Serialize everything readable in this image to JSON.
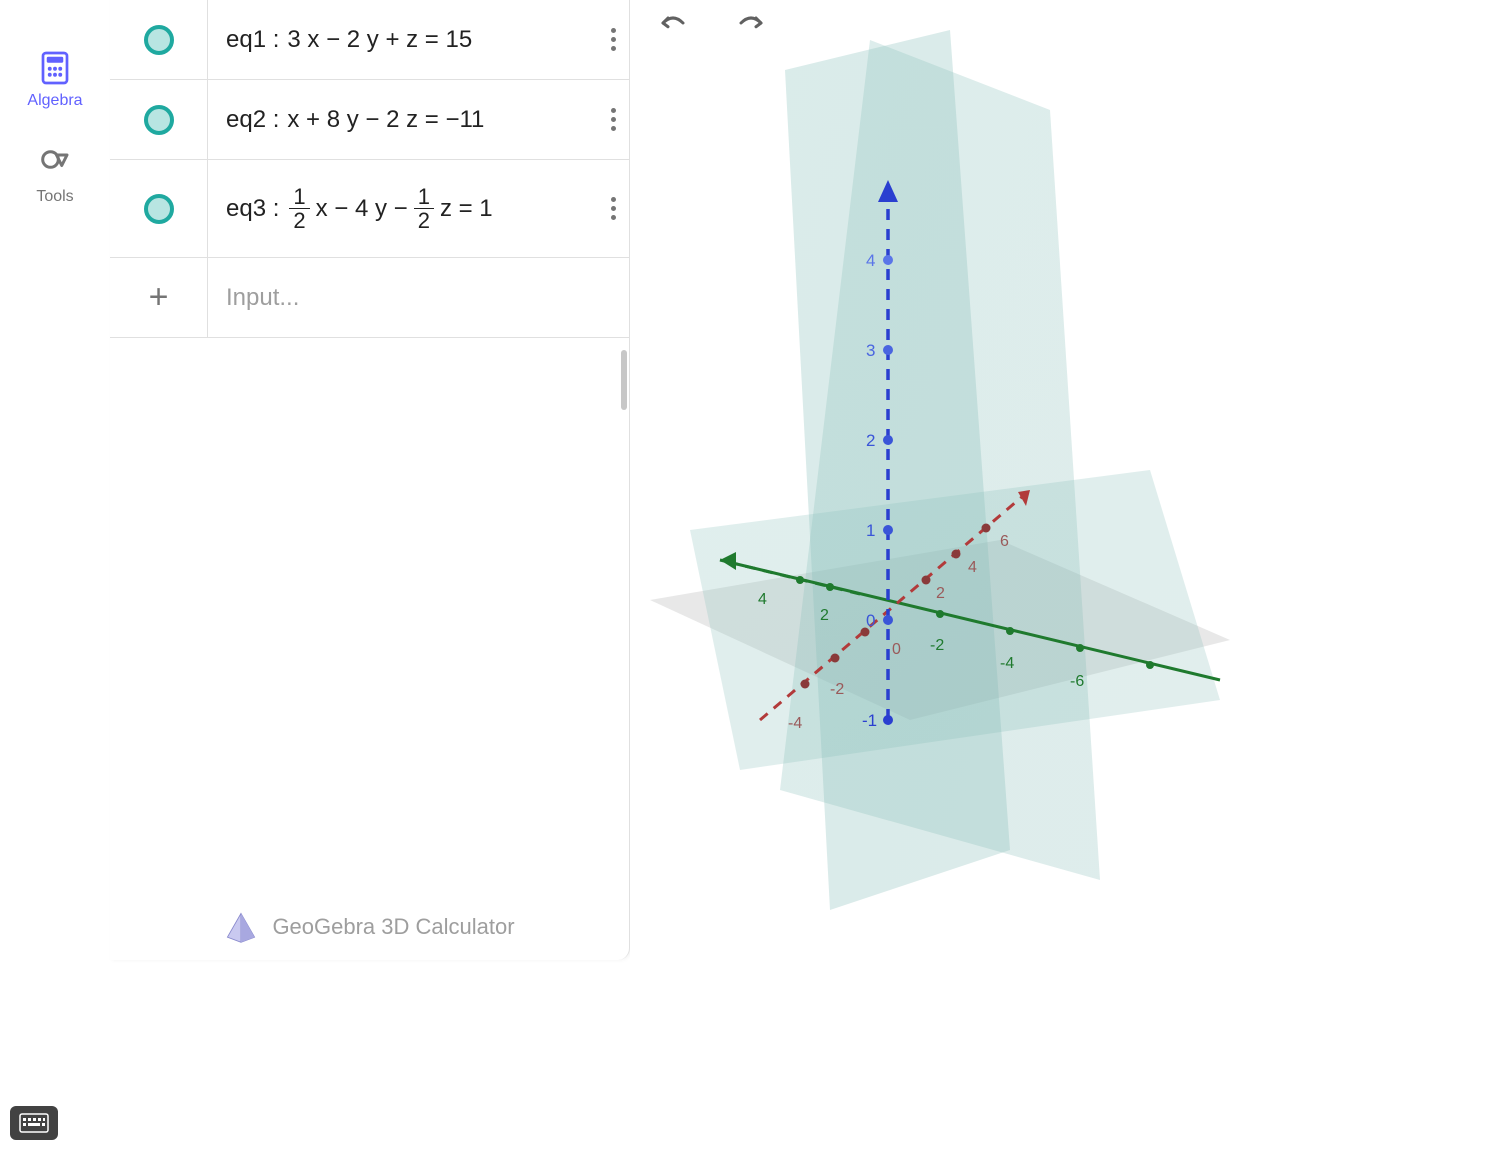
{
  "nav": {
    "algebra": "Algebra",
    "tools": "Tools"
  },
  "equations": [
    {
      "name": "eq1",
      "display": "3 x − 2 y + z  =  15",
      "type": "plain"
    },
    {
      "name": "eq2",
      "display": "x + 8 y − 2 z  =  −11",
      "type": "plain"
    },
    {
      "name": "eq3",
      "display_parts": {
        "prefix": "",
        "frac1_num": "1",
        "frac1_den": "2",
        "mid1": " x − 4 y − ",
        "frac2_num": "1",
        "frac2_den": "2",
        "mid2": " z  =  1"
      },
      "type": "frac"
    }
  ],
  "input_placeholder": "Input...",
  "brand": "GeoGebra 3D Calculator",
  "axes3d": {
    "z_ticks": [
      "4",
      "3",
      "2",
      "1",
      "0",
      "-1"
    ],
    "y_pos_ticks": [
      "-2",
      "-4",
      "-6"
    ],
    "y_neg_ticks": [
      "2",
      "4"
    ],
    "x_pos_ticks": [
      "2",
      "4",
      "6"
    ],
    "x_neg_ticks": [
      "0",
      "-2",
      "-4"
    ],
    "colors": {
      "x": "#b23a3a",
      "y": "#1f7a2e",
      "z": "#2a3fd0",
      "plane": "#72b5b0",
      "floor": "#b5b5b5"
    }
  }
}
